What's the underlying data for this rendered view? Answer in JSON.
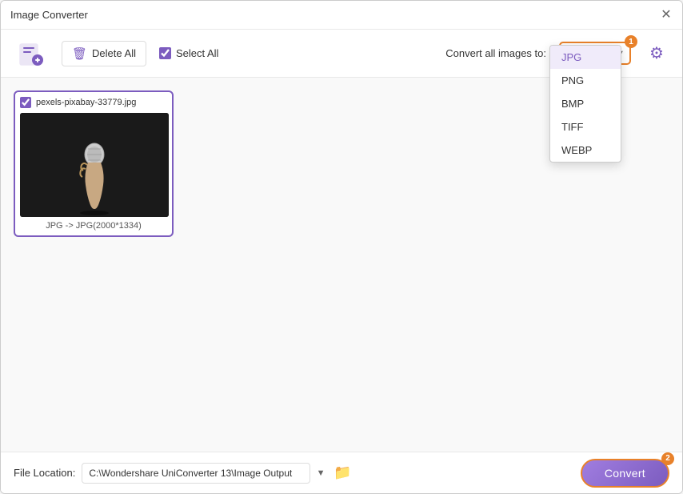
{
  "window": {
    "title": "Image Converter"
  },
  "toolbar": {
    "add_button_label": "+",
    "delete_all_label": "Delete All",
    "select_all_label": "Select All",
    "select_all_checked": true,
    "convert_label": "Convert all images to:",
    "format_value": "JPG",
    "settings_icon": "⚙"
  },
  "format_options": [
    "JPG",
    "PNG",
    "BMP",
    "TIFF",
    "WEBP"
  ],
  "badge1": "1",
  "badge2": "2",
  "image_card": {
    "filename": "pexels-pixabay-33779.jpg",
    "checked": true,
    "info": "JPG -> JPG(2000*1334)"
  },
  "footer": {
    "file_location_label": "File Location:",
    "file_location_value": "C:\\Wondershare UniConverter 13\\Image Output",
    "convert_btn_label": "Convert"
  }
}
